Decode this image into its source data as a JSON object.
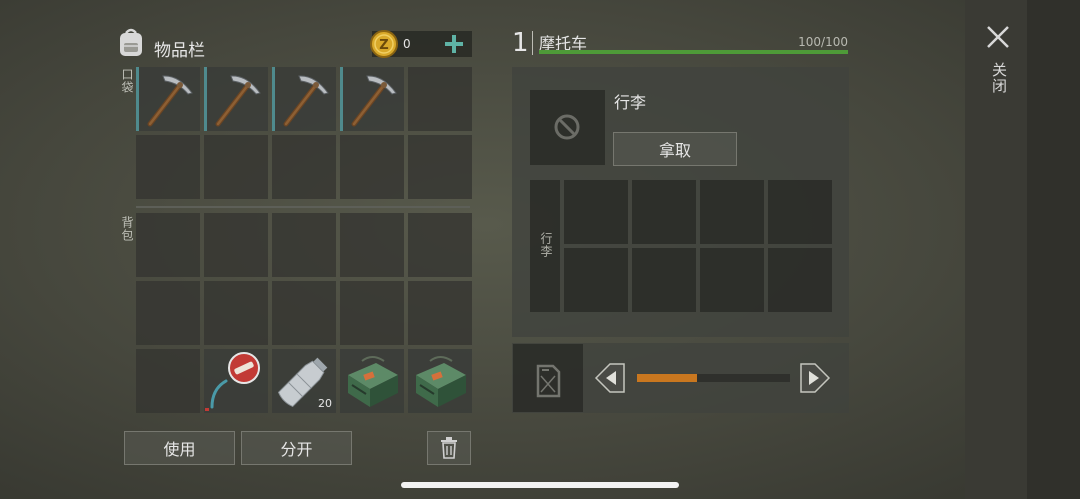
{
  "inventory": {
    "title": "物品栏",
    "coin_count": "0",
    "pockets_label": "口袋",
    "backpack_label": "背包",
    "water_bottle_qty": "20",
    "use_label": "使用",
    "split_label": "分开"
  },
  "vehicle": {
    "level": "1",
    "name": "摩托车",
    "durability_text": "100/100",
    "durability_fraction": 1.0,
    "luggage_title": "行李",
    "take_label": "拿取",
    "luggage_grid_label": "行李",
    "fuel_fraction": 0.39
  },
  "close_label": "关闭",
  "colors": {
    "durability_green": "#4e9a38",
    "fuel_orange": "#c9771f",
    "teal_plus": "#5fb3a6",
    "coin_gold": "#d9a92a"
  }
}
